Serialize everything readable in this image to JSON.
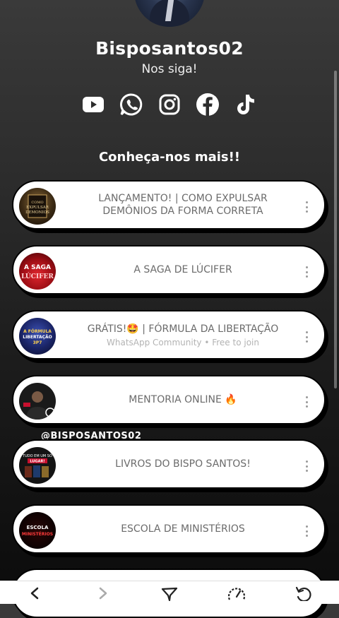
{
  "profile": {
    "name": "Bisposantos02",
    "subtitle": "Nos siga!",
    "socials": [
      "youtube-icon",
      "whatsapp-icon",
      "instagram-icon",
      "facebook-icon",
      "tiktok-icon"
    ]
  },
  "section": {
    "title": "Conheça-nos mais!!"
  },
  "links": [
    {
      "title": "LANÇAMENTO! | COMO EXPULSAR DEMÔNIOS DA FORMA CORRETA",
      "subtitle": "",
      "thumb_text": "COMO EXPULSAR DEMONIOS"
    },
    {
      "title": "A SAGA DE LÚCIFER",
      "subtitle": "",
      "thumb_text": "A SAGA LÚCIFER"
    },
    {
      "title": "GRÁTIS!🤩 | FÓRMULA DA LIBERTAÇÃO",
      "subtitle": "WhatsApp Community • Free to join",
      "thumb_text": "A FÓRMULA LIBERTAÇÃO 3P7"
    },
    {
      "title": "MENTORIA ONLINE 🔥",
      "subtitle": "",
      "thumb_text": ""
    },
    {
      "title": "LIVROS DO BISPO SANTOS!",
      "subtitle": "",
      "thumb_text": "TUDO EM UM SÓ LUGAR"
    },
    {
      "title": "ESCOLA DE MINISTÉRIOS",
      "subtitle": "",
      "thumb_text": "ESCOLA MINISTÉRIOS"
    }
  ],
  "overlay": {
    "handle": "@BISPOSANTOS02"
  },
  "colors": {
    "card_bg": "#ffffff",
    "card_text": "#6b6b6b",
    "brand_red": "#c8102e",
    "page_bg_top": "#3a3a3a",
    "page_bg_bottom": "#0b0b0b"
  },
  "browser_bar": [
    "back-icon",
    "forward-icon",
    "filter-icon",
    "speed-icon",
    "reload-icon"
  ]
}
